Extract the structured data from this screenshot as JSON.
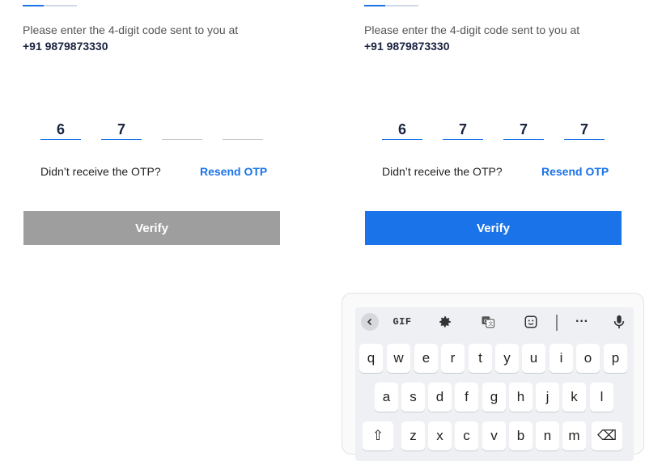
{
  "screens": [
    {
      "state": "partial",
      "progress_fraction": 0.4,
      "instruction": "Please enter the 4-digit code sent to you at",
      "phone": "+91 9879873330",
      "otp_digits": [
        "6",
        "7",
        "",
        ""
      ],
      "didnt_receive": "Didn’t receive the OTP?",
      "resend_label": "Resend OTP",
      "verify_label": "Verify",
      "verify_enabled": false
    },
    {
      "state": "complete",
      "progress_fraction": 0.4,
      "instruction": "Please enter the 4-digit code sent to you at",
      "phone": "+91 9879873330",
      "otp_digits": [
        "6",
        "7",
        "7",
        "7"
      ],
      "didnt_receive": "Didn’t receive the OTP?",
      "resend_label": "Resend OTP",
      "verify_label": "Verify",
      "verify_enabled": true
    }
  ],
  "keyboard": {
    "toolbar": {
      "gif_label": "GIF",
      "icons": [
        "back-icon",
        "gif-button",
        "settings-icon",
        "translate-icon",
        "sticker-icon",
        "more-icon",
        "microphone-icon"
      ],
      "more_label": "···"
    },
    "rows": [
      [
        "q",
        "w",
        "e",
        "r",
        "t",
        "y",
        "u",
        "i",
        "o",
        "p"
      ],
      [
        "a",
        "s",
        "d",
        "f",
        "g",
        "h",
        "j",
        "k",
        "l"
      ],
      [
        "⇧",
        "z",
        "x",
        "c",
        "v",
        "b",
        "n",
        "m",
        "⌫"
      ]
    ]
  },
  "colors": {
    "accent": "#1a73e8",
    "disabled": "#9e9e9e",
    "text_dark": "#1a2340"
  }
}
